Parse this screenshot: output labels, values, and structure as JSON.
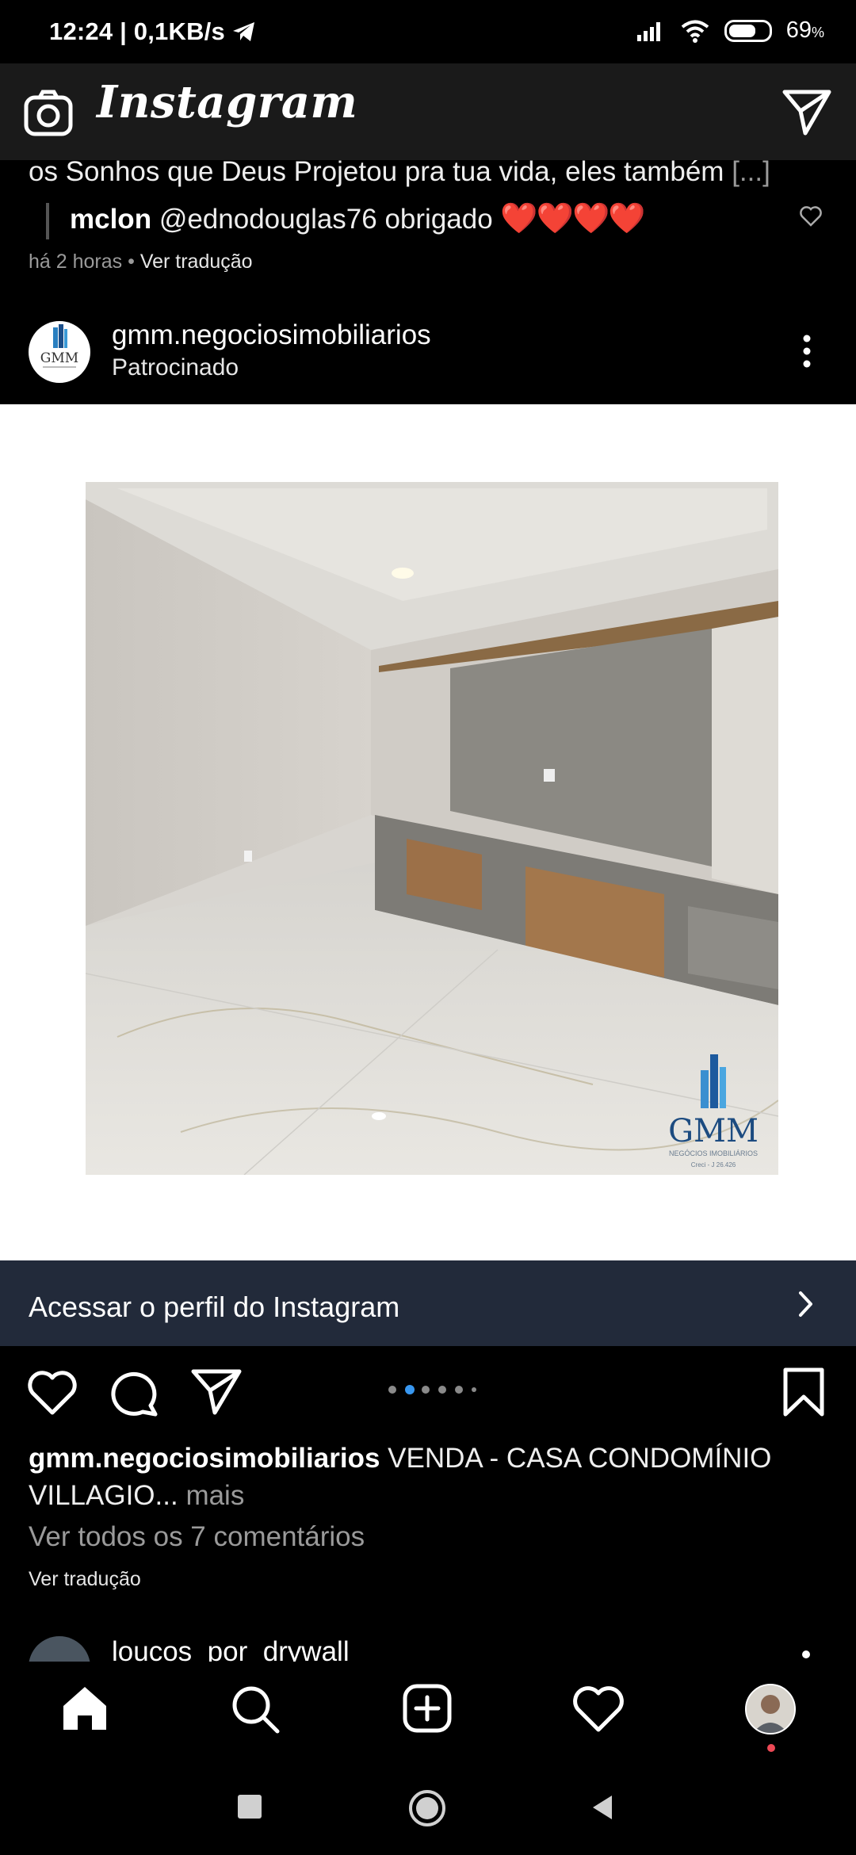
{
  "status_bar": {
    "time_speed": "12:24 | 0,1KB/s",
    "battery_label": "69",
    "battery_level": 0.69
  },
  "header": {
    "title": "Instagram",
    "camera_icon": "camera-icon",
    "direct_icon": "paper-plane-icon"
  },
  "previous_post": {
    "caption_tail": "os Sonhos que Deus Projetou pra tua vida, eles também",
    "caption_more": "[...]",
    "reply_user": "mclon",
    "reply_text": "@ednodouglas76 obrigado",
    "reply_hearts": "❤️❤️❤️❤️",
    "time": "há 2 horas",
    "separator": "•",
    "translate": "Ver tradução"
  },
  "post": {
    "account": "gmm.negociosimobiliarios",
    "sponsored": "Patrocinado",
    "avatar_text": "GMM",
    "watermark": "GMM",
    "watermark_sub": "NEGÓCIOS IMOBILIÁRIOS",
    "watermark_creci": "Creci - J 26.426",
    "cta": "Acessar o perfil do Instagram",
    "caption_user": "gmm.negociosimobiliarios",
    "caption_text": "VENDA - CASA CONDOMÍNIO VILLAGIO...",
    "caption_more": "mais",
    "view_comments": "Ver todos os 7 comentários",
    "translate": "Ver tradução",
    "carousel_count": 6,
    "carousel_active": 1
  },
  "next_post": {
    "account": "loucos_por_drywall"
  },
  "bottom_nav": [
    "home-icon",
    "search-icon",
    "new-post-icon",
    "activity-icon",
    "profile-avatar"
  ],
  "system_nav": [
    "recents-button",
    "home-button",
    "back-button"
  ],
  "colors": {
    "cta_bg": "#222a3a",
    "heart_red": "#e0212d",
    "active_dot": "#3897f0"
  }
}
